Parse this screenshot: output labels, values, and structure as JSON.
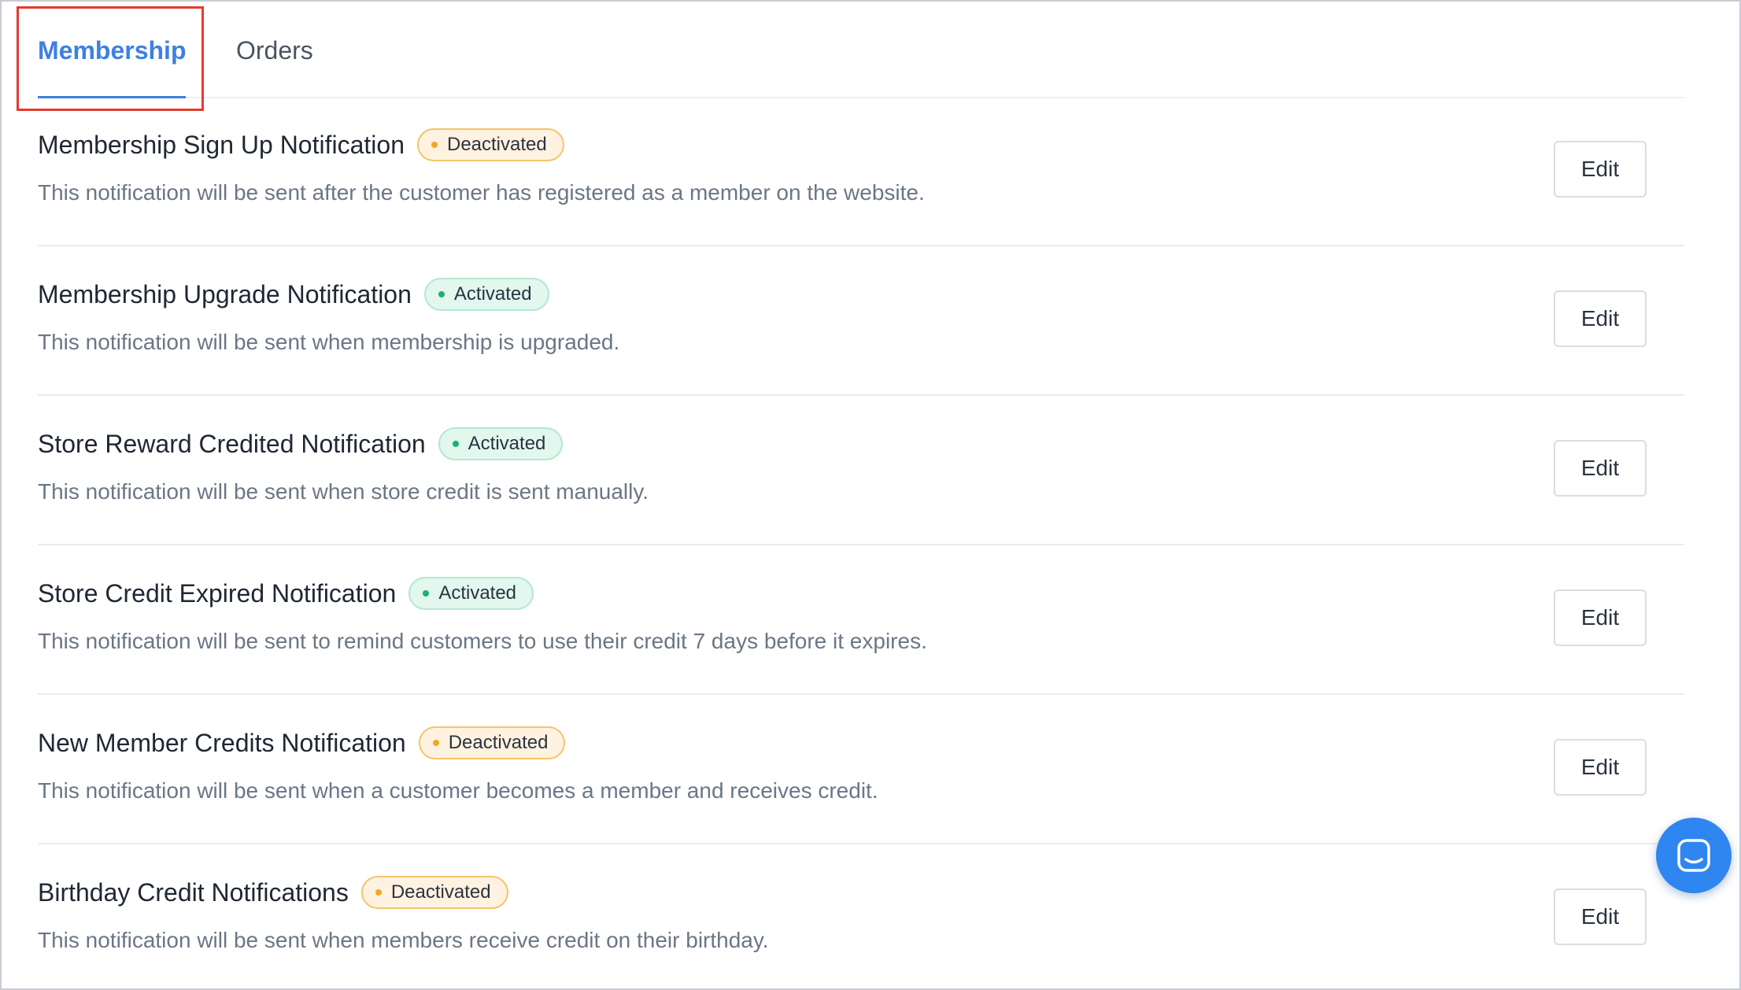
{
  "tabs": [
    {
      "label": "Membership",
      "active": true
    },
    {
      "label": "Orders",
      "active": false
    }
  ],
  "edit_label": "Edit",
  "notifications": [
    {
      "title": "Membership Sign Up Notification",
      "status": "Deactivated",
      "description": "This notification will be sent after the customer has registered as a member on the website."
    },
    {
      "title": "Membership Upgrade Notification",
      "status": "Activated",
      "description": "This notification will be sent when membership is upgraded."
    },
    {
      "title": "Store Reward Credited Notification",
      "status": "Activated",
      "description": "This notification will be sent when store credit is sent manually."
    },
    {
      "title": "Store Credit Expired Notification",
      "status": "Activated",
      "description": "This notification will be sent to remind customers to use their credit 7 days before it expires."
    },
    {
      "title": "New Member Credits Notification",
      "status": "Deactivated",
      "description": "This notification will be sent when a customer becomes a member and receives credit."
    },
    {
      "title": "Birthday Credit Notifications",
      "status": "Deactivated",
      "description": "This notification will be sent when members receive credit on their birthday."
    }
  ],
  "colors": {
    "accent": "#3e80e0",
    "highlight": "#e53a2f",
    "deactivated_dot": "#f5a623",
    "activated_dot": "#1fae74",
    "chat_button": "#2f86f0"
  },
  "chat_widget": {
    "icon": "chat-icon"
  }
}
